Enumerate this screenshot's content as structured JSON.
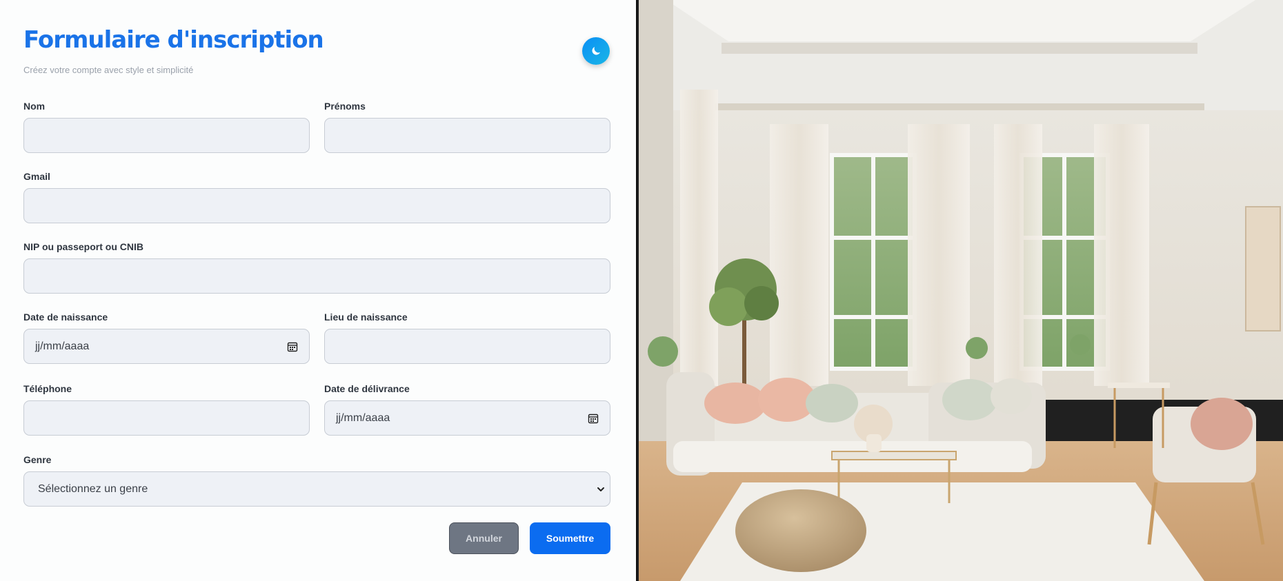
{
  "form": {
    "title": "Formulaire d'inscription",
    "subtitle": "Créez votre compte avec style et simplicité",
    "fields": {
      "nom": {
        "label": "Nom",
        "value": ""
      },
      "prenoms": {
        "label": "Prénoms",
        "value": ""
      },
      "gmail": {
        "label": "Gmail",
        "value": ""
      },
      "id_doc": {
        "label": "NIP ou passeport ou CNIB",
        "value": ""
      },
      "birth_date": {
        "label": "Date de naissance",
        "placeholder": "jj/mm/aaaa"
      },
      "birth_place": {
        "label": "Lieu de naissance",
        "value": ""
      },
      "phone": {
        "label": "Téléphone",
        "value": ""
      },
      "issue_date": {
        "label": "Date de délivrance",
        "placeholder": "jj/mm/aaaa"
      },
      "genre": {
        "label": "Genre",
        "selected": "Sélectionnez un genre"
      }
    },
    "buttons": {
      "cancel": "Annuler",
      "submit": "Soumettre"
    }
  },
  "icons": {
    "theme_toggle": "moon-icon",
    "calendar": "calendar-icon",
    "select_arrow": "chevron-down-icon"
  },
  "colors": {
    "accent": "#1a73e8",
    "submit": "#0b6cf0",
    "cancel": "#6e7683",
    "input_bg": "#eef1f6"
  }
}
